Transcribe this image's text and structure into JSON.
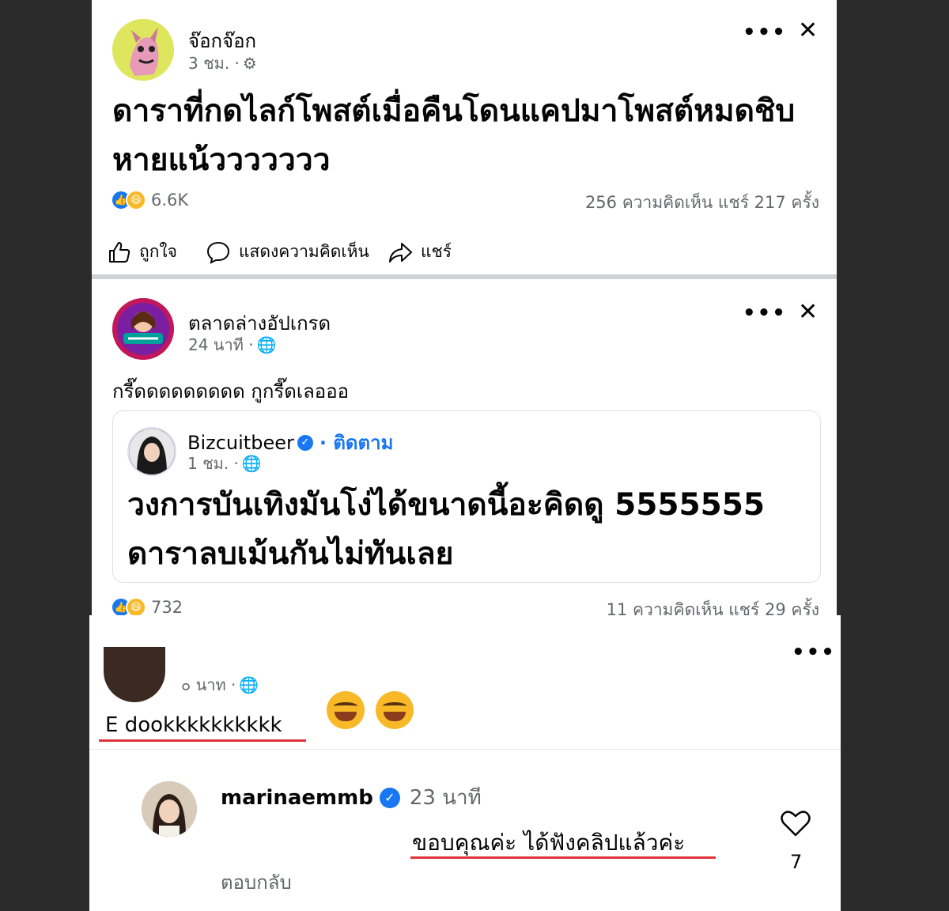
{
  "post1": {
    "author": "จ๊อกจ๊อก",
    "time": "3 ชม. ·",
    "more_label": "•••",
    "close_label": "✕",
    "text": "ดาราที่กดไลก์โพสต์เมื่อคืนโดนแคปมาโพสต์หมดชิบหายแน้ววววววว",
    "reaction_count": "6.6K",
    "stats": "256 ความคิดเห็น  แชร์ 217 ครั้ง",
    "actions": {
      "like": "ถูกใจ",
      "comment": "แสดงความคิดเห็น",
      "share": "แชร์"
    }
  },
  "post2": {
    "author": "ตลาดล่างอัปเกรด",
    "time": "24 นาที ·",
    "more_label": "•••",
    "close_label": "✕",
    "caption": "กรี๊ดดดดดดดดด กูกรี๊ดเลอออ",
    "shared": {
      "author": "Bizcuitbeer",
      "follow": "· ติดตาม",
      "time": "1 ชม. ·",
      "text": "วงการบันเทิงมันโง่ได้ขนาดนี้อะคิดดู 5555555 ดาราลบเม้นกันไม่ทันเลย"
    },
    "reaction_count": "732",
    "stats": "11 ความคิดเห็น  แชร์ 29 ครั้ง"
  },
  "comments": {
    "more_label": "•••",
    "comment1": {
      "time": "๐ นาท ·",
      "text": "E dookkkkkkkkkk"
    },
    "reply": {
      "author": "marinaemmb",
      "time": "23 นาที",
      "text": "ขอบคุณค่ะ ได้ฟังคลิปแล้วค่ะ",
      "reply_label": "ตอบกลับ",
      "like_count": "7"
    }
  },
  "colors": {
    "accent": "#1877f2",
    "highlight": "#e0323a",
    "muted": "#65676b"
  }
}
